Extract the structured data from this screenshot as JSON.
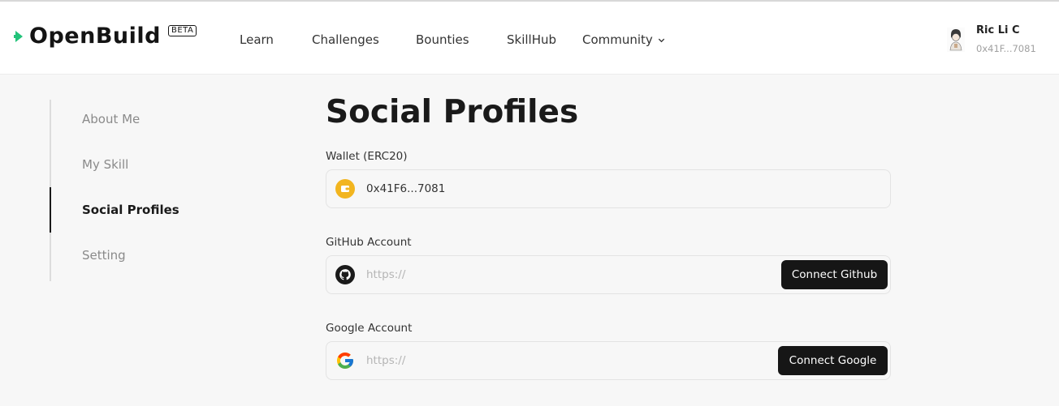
{
  "brand": {
    "name": "OpenBuild",
    "badge": "BETA",
    "accent_color": "#23c37a"
  },
  "nav": {
    "items": [
      {
        "label": "Learn"
      },
      {
        "label": "Challenges"
      },
      {
        "label": "Bounties"
      },
      {
        "label": "SkillHub"
      },
      {
        "label": "Community",
        "icon": "chevron-down-icon"
      }
    ]
  },
  "user": {
    "name": "Ric Li C",
    "address": "0x41F...7081",
    "avatar": "avatar-illustration"
  },
  "sidebar": {
    "items": [
      {
        "label": "About Me",
        "active": false
      },
      {
        "label": "My Skill",
        "active": false
      },
      {
        "label": "Social Profiles",
        "active": true
      },
      {
        "label": "Setting",
        "active": false
      }
    ]
  },
  "main": {
    "title": "Social Profiles",
    "wallet": {
      "label": "Wallet (ERC20)",
      "value": "0x41F6...7081",
      "icon": "wallet-icon",
      "icon_color": "#f2b51f"
    },
    "github": {
      "label": "GitHub Account",
      "placeholder": "https://",
      "value": "",
      "icon": "github-icon",
      "button_label": "Connect Github"
    },
    "google": {
      "label": "Google Account",
      "placeholder": "https://",
      "value": "",
      "icon": "google-icon",
      "button_label": "Connect Google"
    }
  }
}
